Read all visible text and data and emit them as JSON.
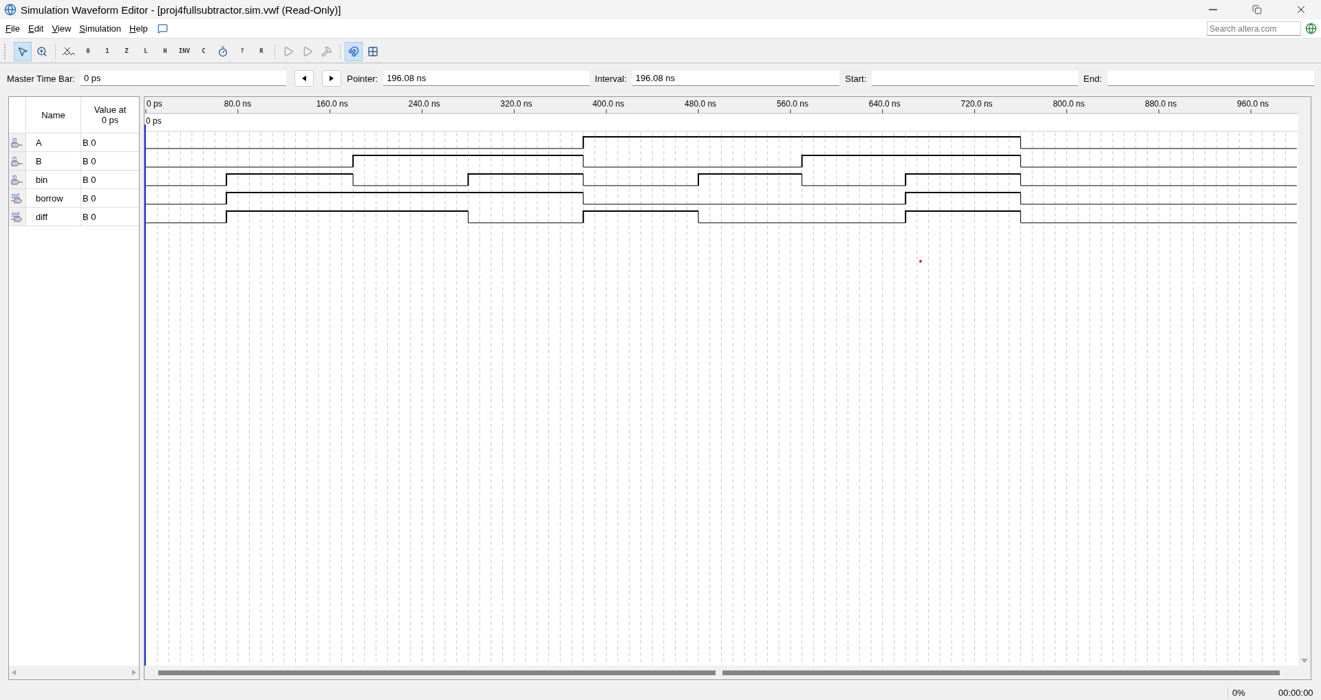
{
  "window": {
    "title": "Simulation Waveform Editor - [proj4fullsubtractor.sim.vwf (Read-Only)]"
  },
  "menu": [
    {
      "label": "File"
    },
    {
      "label": "Edit"
    },
    {
      "label": "View"
    },
    {
      "label": "Simulation"
    },
    {
      "label": "Help"
    }
  ],
  "search": {
    "placeholder": "Search altera.com"
  },
  "toolbar": [
    {
      "kind": "pointer",
      "selected": true
    },
    {
      "kind": "zoom",
      "selected": false
    },
    {
      "kind": "separator"
    },
    {
      "kind": "unknown",
      "selected": false
    },
    {
      "kind": "low",
      "glyph": "0",
      "selected": false
    },
    {
      "kind": "high",
      "glyph": "1",
      "selected": false
    },
    {
      "kind": "z",
      "glyph": "Z",
      "selected": false
    },
    {
      "kind": "weak",
      "glyph": "L",
      "selected": false
    },
    {
      "kind": "weak",
      "glyph": "H",
      "selected": false
    },
    {
      "kind": "invert",
      "glyph": "INV",
      "selected": false
    },
    {
      "kind": "weak",
      "glyph": "C",
      "selected": false
    },
    {
      "kind": "clock",
      "selected": false
    },
    {
      "kind": "weak",
      "glyph": "?",
      "selected": false
    },
    {
      "kind": "weak",
      "glyph": "R",
      "selected": false
    },
    {
      "kind": "separator"
    },
    {
      "kind": "run",
      "selected": false
    },
    {
      "kind": "run-timing",
      "selected": false
    },
    {
      "kind": "build",
      "selected": false
    },
    {
      "kind": "separator"
    },
    {
      "kind": "snap",
      "selected": true
    },
    {
      "kind": "grid",
      "selected": false
    }
  ],
  "time_bar": {
    "master_label": "Master Time Bar:",
    "master_value": "0 ps",
    "pointer_label": "Pointer:",
    "pointer_value": "196.08 ns",
    "interval_label": "Interval:",
    "interval_value": "196.08 ns",
    "start_label": "Start:",
    "end_label": "End:"
  },
  "signals_table": {
    "columns": [
      "Name",
      "Value at 0 ps"
    ],
    "rows": [
      {
        "direction": "in",
        "name": "A",
        "value": "B 0",
        "waveform": [
          {
            "high": false
          },
          {
            "high": false
          },
          {
            "high": false
          },
          {
            "high": false
          },
          {
            "high": true
          },
          {
            "high": true
          },
          {
            "high": true
          },
          {
            "high": true
          },
          {
            "high": false
          }
        ]
      },
      {
        "direction": "in",
        "name": "B",
        "value": "B 0",
        "waveform": [
          {
            "high": false
          },
          {
            "high": false
          },
          {
            "high": true
          },
          {
            "high": true
          },
          {
            "high": false
          },
          {
            "high": false
          },
          {
            "high": true
          },
          {
            "high": true
          },
          {
            "high": false
          }
        ]
      },
      {
        "direction": "in",
        "name": "bin",
        "value": "B 0",
        "waveform": [
          {
            "high": false
          },
          {
            "high": true
          },
          {
            "high": false
          },
          {
            "high": true
          },
          {
            "high": false
          },
          {
            "high": true
          },
          {
            "high": false
          },
          {
            "high": true
          },
          {
            "high": false
          }
        ]
      },
      {
        "direction": "out",
        "name": "borrow",
        "value": "B 0",
        "waveform": [
          {
            "high": false
          },
          {
            "high": true
          },
          {
            "high": true
          },
          {
            "high": true
          },
          {
            "high": false
          },
          {
            "high": false
          },
          {
            "high": false
          },
          {
            "high": true
          },
          {
            "high": false
          }
        ]
      },
      {
        "direction": "out",
        "name": "diff",
        "value": "B 0",
        "waveform": [
          {
            "high": false
          },
          {
            "high": true
          },
          {
            "high": true
          },
          {
            "high": false
          },
          {
            "high": true
          },
          {
            "high": false
          },
          {
            "high": false
          },
          {
            "high": true
          },
          {
            "high": false
          }
        ]
      }
    ]
  },
  "ruler": {
    "ticks": [
      "0 ps",
      "80.0 ns",
      "160.0 ns",
      "240.0 ns",
      "320.0 ns",
      "400.0 ns",
      "480.0 ns",
      "560.0 ns",
      "640.0 ns",
      "720.0 ns",
      "800.0 ns",
      "880.0 ns",
      "960.0 ns"
    ],
    "marker_label": "0 ps"
  },
  "status_bar": {
    "progress": "0%",
    "elapsed": "00:00:00"
  }
}
